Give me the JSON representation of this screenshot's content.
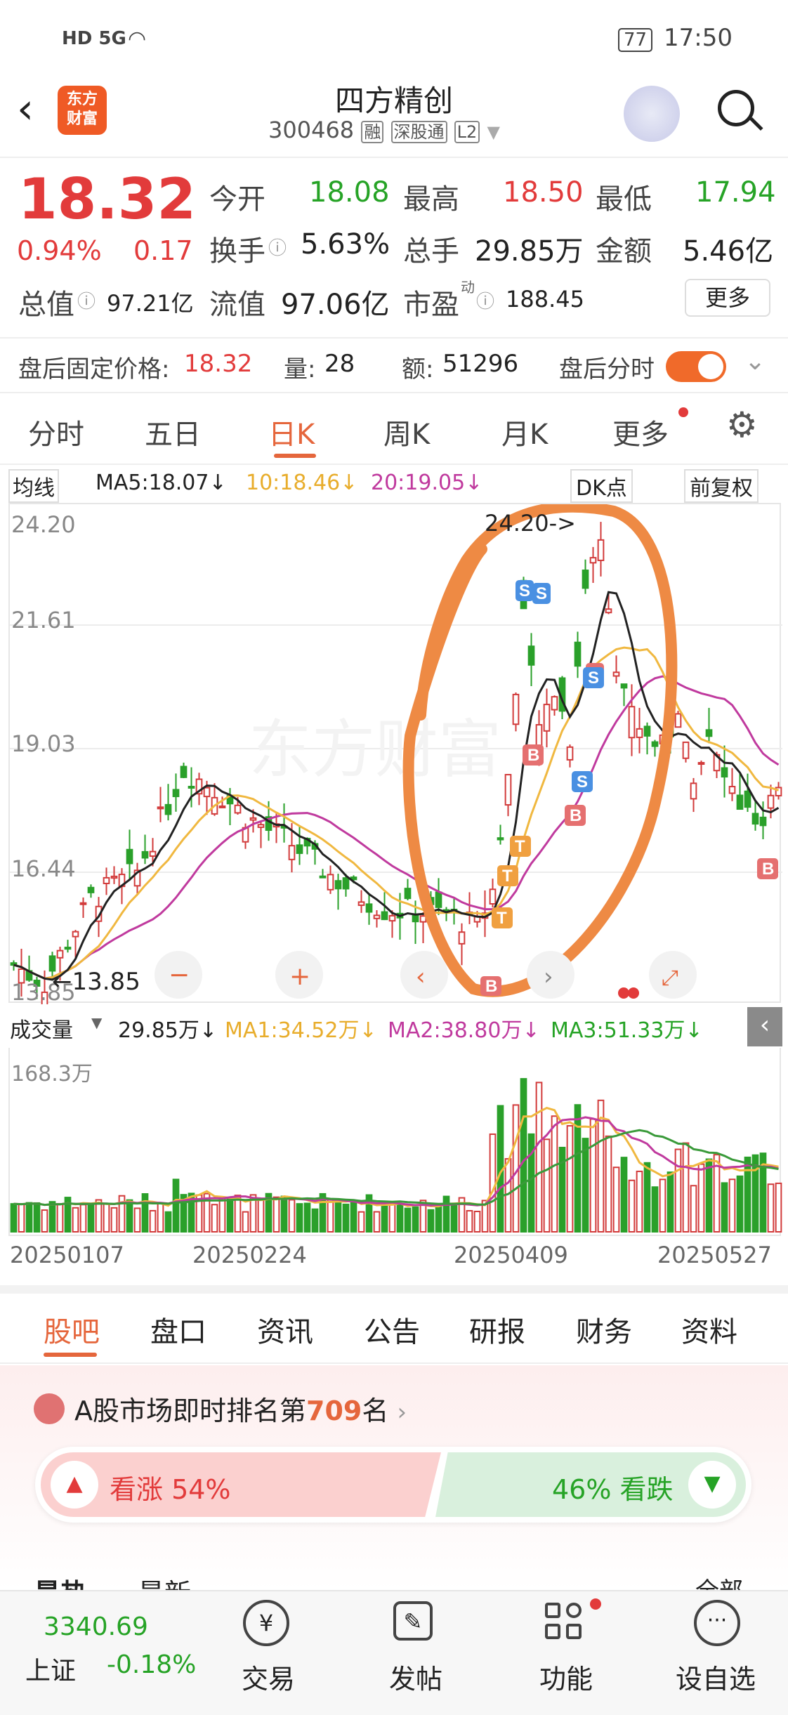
{
  "status": {
    "network": "HD 5G",
    "battery": "77",
    "time": "17:50"
  },
  "header": {
    "logo": "东方\n财富",
    "title": "四方精创",
    "code": "300468",
    "tags": [
      "融",
      "深股通",
      "L2"
    ]
  },
  "quote": {
    "price": "18.32",
    "pct": "0.94%",
    "chg": "0.17",
    "fields": [
      {
        "label": "今开",
        "value": "18.08",
        "color": "green"
      },
      {
        "label": "最高",
        "value": "18.50",
        "color": "red"
      },
      {
        "label": "最低",
        "value": "17.94",
        "color": "green"
      },
      {
        "label": "换手",
        "value": "5.63%",
        "color": "dark"
      },
      {
        "label": "总手",
        "value": "29.85万",
        "color": "dark"
      },
      {
        "label": "金额",
        "value": "5.46亿",
        "color": "dark"
      }
    ],
    "zongzhi_label": "总值",
    "zongzhi": "97.21亿",
    "liuzhi_label": "流值",
    "liuzhi": "97.06亿",
    "shiying_label": "市盈",
    "shiying_sup": "动",
    "shiying": "188.45",
    "more_button": "更多"
  },
  "after_hours": {
    "price_label": "盘后固定价格:",
    "price": "18.32",
    "vol_label": "量:",
    "vol": "28",
    "amt_label": "额:",
    "amt": "51296",
    "toggle_label": "盘后分时"
  },
  "tabs": [
    "分时",
    "五日",
    "日K",
    "周K",
    "月K",
    "更多"
  ],
  "active_tab": "日K",
  "ma_bar": {
    "selector": "均线",
    "ma5": "MA5:18.07↓",
    "ma10": "10:18.46↓",
    "ma20": "20:19.05↓",
    "dk": "DK点",
    "fuquan": "前复权"
  },
  "kline": {
    "y_ticks": [
      "24.20",
      "21.61",
      "19.03",
      "16.44",
      "13.85"
    ],
    "high_marker": "24.20->",
    "low_marker": "←13.85",
    "watermark": "东方财富"
  },
  "volume_bar": {
    "selector": "成交量",
    "vol": "29.85万↓",
    "ma1": "MA1:34.52万↓",
    "ma2": "MA2:38.80万↓",
    "ma3": "MA3:51.33万↓",
    "max_label": "168.3万"
  },
  "dates": [
    "20250107",
    "20250224",
    "20250409",
    "20250527"
  ],
  "section_tabs": [
    "股吧",
    "盘口",
    "资讯",
    "公告",
    "研报",
    "财务",
    "资料"
  ],
  "ranking": {
    "prefix": "A股市场即时排名第",
    "rank": "709",
    "suffix": "名"
  },
  "vote": {
    "up": "看涨 54%",
    "down": "46% 看跌",
    "up_pct": 54
  },
  "sub_tabs": [
    "最热",
    "最新",
    "全部"
  ],
  "bottom_nav": {
    "index_value": "3340.69",
    "index_name": "上证",
    "index_chg": "-0.18%",
    "items": [
      "交易",
      "发帖",
      "功能",
      "设自选"
    ]
  },
  "colors": {
    "up": "#e23b3b",
    "down": "#26a326",
    "accent": "#e5663c",
    "ma5": "#222222",
    "ma10": "#f0b840",
    "ma20": "#c03a9e"
  }
}
